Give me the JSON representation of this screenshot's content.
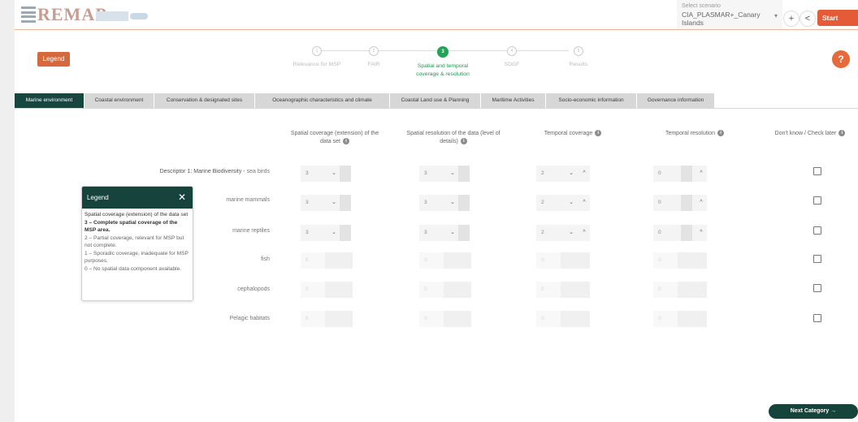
{
  "header": {
    "logo_text": "REMAP",
    "logo_sup": "",
    "project": {
      "label": "Select scenario",
      "value": "CIA_PLASMAR+_Canary Islands"
    },
    "plus_label": "+",
    "share_label": "<",
    "start_tutorial_label": "Start Tutorial"
  },
  "legend_button_label": "Legend",
  "help_label": "?",
  "steps": [
    {
      "number": "1",
      "label": "Relevance for MSP"
    },
    {
      "number": "2",
      "label": "FAIR"
    },
    {
      "number": "3",
      "label": "Spatial and temporal coverage & resolution"
    },
    {
      "number": "4",
      "label": "SDGF"
    },
    {
      "number": "5",
      "label": "Results"
    }
  ],
  "tabs": [
    "Marine environment",
    "Coastal environment",
    "Conservation & designated sites",
    "Oceanographic characteristics and climate",
    "Coastal Land use & Planning",
    "Maritime Activities",
    "Socio-economic information",
    "Governance information"
  ],
  "columns": [
    "Spatial coverage (extension) of the data set",
    "Spatial resolution of the data (level of details)",
    "Temporal coverage",
    "Temporal resolution",
    "Don't know / Check later"
  ],
  "descriptor_label": "Descriptor 1: Marine Biodiversity -",
  "rows": [
    {
      "label": "sea birds",
      "values": [
        "3",
        "3",
        "2",
        "0"
      ]
    },
    {
      "label": "marine mammals",
      "values": [
        "3",
        "3",
        "2",
        "0"
      ]
    },
    {
      "label": "marine reptiles",
      "values": [
        "3",
        "3",
        "2",
        "0"
      ]
    },
    {
      "label": "fish",
      "values": [
        "0",
        "0",
        "0",
        "0"
      ]
    },
    {
      "label": "cephalopods",
      "values": [
        "0",
        "0",
        "0",
        "0"
      ]
    },
    {
      "label": "Pelagic habitats",
      "values": [
        "0",
        "0",
        "0",
        "0"
      ]
    }
  ],
  "legend_panel": {
    "title": "Legend",
    "close": "✕",
    "heading": "Spatial coverage (extension) of the data set",
    "item3": "3 – Complete spatial coverage of the MSP area.",
    "item2": "2 – Partial coverage, relevant for MSP but not complete.",
    "item1": "1 – Sporadic coverage, inadequate for MSP purposes.",
    "item0": "0 – No spatial data component available."
  },
  "next_button_label": "Next Category →",
  "colors": {
    "accent": "#e55a37",
    "primary": "#16433c",
    "active_step": "#22a355"
  }
}
